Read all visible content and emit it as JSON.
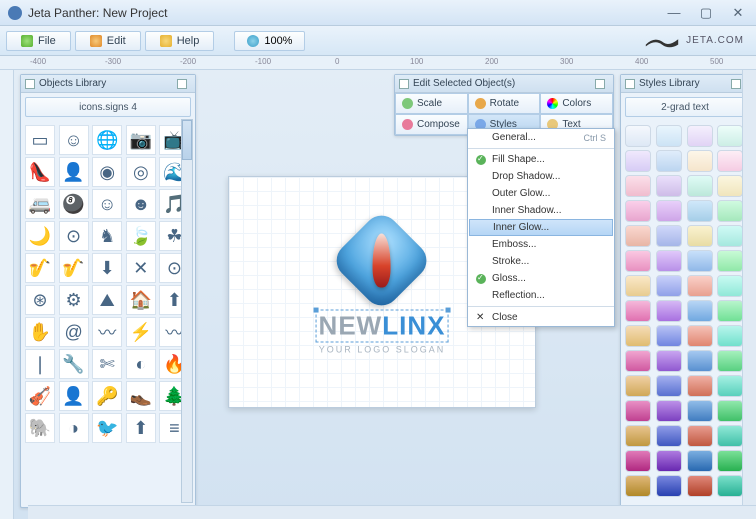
{
  "title": "Jeta Panther: New Project",
  "menu": {
    "file": "File",
    "edit": "Edit",
    "help": "Help",
    "zoom": "100%"
  },
  "brand": "JETA.COM",
  "ruler_marks": [
    "-400",
    "-300",
    "-200",
    "-100",
    "0",
    "100",
    "200",
    "300",
    "400",
    "500"
  ],
  "objects_panel": {
    "title": "Objects Library",
    "category": "icons.signs 4"
  },
  "styles_panel": {
    "title": "Styles Library",
    "category": "2-grad text"
  },
  "edit_panel": {
    "title": "Edit Selected Object(s)",
    "buttons": [
      "Scale",
      "Rotate",
      "Colors",
      "Compose",
      "Styles",
      "Text"
    ]
  },
  "dropdown": {
    "general": "General...",
    "general_sc": "Ctrl S",
    "items": [
      "Fill Shape...",
      "Drop Shadow...",
      "Outer Glow...",
      "Inner Shadow...",
      "Inner Glow...",
      "Emboss...",
      "Stroke...",
      "Gloss...",
      "Reflection..."
    ],
    "checked": [
      0,
      7
    ],
    "highlighted": 4,
    "close": "Close"
  },
  "logo": {
    "line1a": "NEW",
    "line1b": "LINX",
    "tagline": "YOUR LOGO SLOGAN"
  },
  "icon_glyphs": [
    "▭",
    "☺",
    "🌐",
    "📷",
    "📺",
    "👠",
    "👤",
    "◉",
    "◎",
    "🌊",
    "🚐",
    "🎱",
    "☺",
    "☻",
    "🎵",
    "🌙",
    "⊙",
    "♞",
    "🍃",
    "☘",
    "🎷",
    "🎷",
    "⬇",
    "✕",
    "⊙",
    "⊛",
    "⚙",
    "⛰",
    "🏠",
    "⬆",
    "✋",
    "@",
    "〰",
    "⚡",
    "〰",
    "❘",
    "🔧",
    "✄",
    "◐",
    "🔥",
    "🎻",
    "👤",
    "🔑",
    "👞",
    "🌲",
    "🐘",
    "◑",
    "🐦",
    "⬆",
    "≡"
  ],
  "swatch_colors": [
    [
      "#f5f8fd",
      "#dde8f5"
    ],
    [
      "#e9f5fd",
      "#cce3f5"
    ],
    [
      "#f5f0fd",
      "#e1d3f5"
    ],
    [
      "#edfdfa",
      "#cceee5"
    ],
    [
      "#f0e9fd",
      "#d7ccf5"
    ],
    [
      "#e0edfb",
      "#bcd5f0"
    ],
    [
      "#fdf6e9",
      "#f5e5cc"
    ],
    [
      "#fdeef6",
      "#f5cce3"
    ],
    [
      "#fbe0ea",
      "#f0bcce"
    ],
    [
      "#eae0fb",
      "#cebce8"
    ],
    [
      "#e0fbf6",
      "#bce8da"
    ],
    [
      "#fbf6e0",
      "#f0e5bc"
    ],
    [
      "#fad0ea",
      "#e8a5ce"
    ],
    [
      "#e8d0fa",
      "#cea5e8"
    ],
    [
      "#d0e8fa",
      "#a5cee8"
    ],
    [
      "#d0fae0",
      "#a5e8bc"
    ],
    [
      "#fad8d0",
      "#e8b5a5"
    ],
    [
      "#d0d8fa",
      "#a5b5e8"
    ],
    [
      "#faf2d0",
      "#e8dca5"
    ],
    [
      "#d0faf6",
      "#a5e8de"
    ],
    [
      "#fac8e2",
      "#e890c0"
    ],
    [
      "#e0c8fa",
      "#b890e8"
    ],
    [
      "#c8e0fa",
      "#90b8e8"
    ],
    [
      "#c8fad6",
      "#90e8a8"
    ],
    [
      "#fae8c8",
      "#e8cc90"
    ],
    [
      "#c8d0fa",
      "#90a0e8"
    ],
    [
      "#fad0c8",
      "#e8a090"
    ],
    [
      "#c8faf2",
      "#90e8d8"
    ],
    [
      "#f5b8da",
      "#e070b0"
    ],
    [
      "#d5b8f5",
      "#a870e0"
    ],
    [
      "#b8d5f5",
      "#70a8e0"
    ],
    [
      "#b8f5cc",
      "#70e095"
    ],
    [
      "#f5dcb8",
      "#e0bc70"
    ],
    [
      "#b8c2f5",
      "#7085e0"
    ],
    [
      "#f5c2b8",
      "#e08570"
    ],
    [
      "#b8f5ec",
      "#70e0cc"
    ],
    [
      "#f0a5d0",
      "#d058a0"
    ],
    [
      "#c8a5f0",
      "#9058d0"
    ],
    [
      "#a5c8f0",
      "#5890d0"
    ],
    [
      "#a5f0bc",
      "#58d080"
    ],
    [
      "#f0d0a5",
      "#d0a858"
    ],
    [
      "#a5b0f0",
      "#5870d0"
    ],
    [
      "#f0b0a5",
      "#d07058"
    ],
    [
      "#a5f0e2",
      "#58d0bc"
    ],
    [
      "#e890c5",
      "#c04090"
    ],
    [
      "#bc90e8",
      "#7c40c0"
    ],
    [
      "#90bce8",
      "#407cc0"
    ],
    [
      "#90e8ac",
      "#40c068"
    ],
    [
      "#e8c490",
      "#c09840"
    ],
    [
      "#909ce8",
      "#4058c0"
    ],
    [
      "#e89c90",
      "#c05840"
    ],
    [
      "#90e8d6",
      "#40c0a8"
    ],
    [
      "#e07ab8",
      "#b02880"
    ],
    [
      "#ae7ae0",
      "#6828b0"
    ],
    [
      "#7aaee0",
      "#2868b0"
    ],
    [
      "#7ae098",
      "#28b050"
    ],
    [
      "#e0b87a",
      "#b08828"
    ],
    [
      "#7a88e0",
      "#2840b0"
    ],
    [
      "#e0887a",
      "#b04028"
    ],
    [
      "#7ae0ca",
      "#28b094"
    ]
  ]
}
